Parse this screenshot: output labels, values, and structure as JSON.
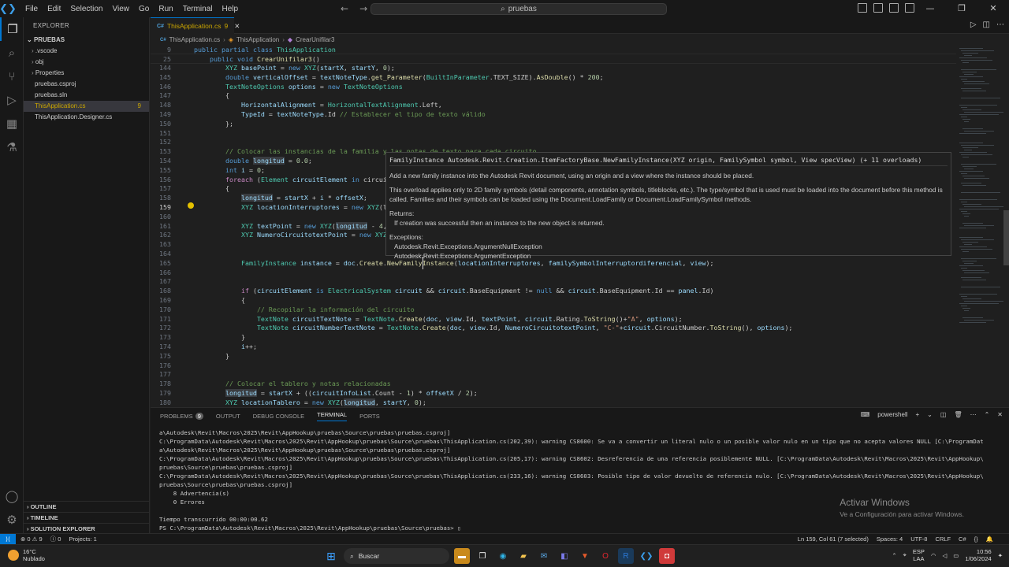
{
  "menu": [
    "File",
    "Edit",
    "Selection",
    "View",
    "Go",
    "Run",
    "Terminal",
    "Help"
  ],
  "search": "pruebas",
  "explorer": {
    "header": "EXPLORER",
    "root": "PRUEBAS",
    "items": [
      {
        "label": ".vscode",
        "type": "folder"
      },
      {
        "label": "obj",
        "type": "folder"
      },
      {
        "label": "Properties",
        "type": "folder"
      },
      {
        "label": "pruebas.csproj",
        "type": "file"
      },
      {
        "label": "pruebas.sln",
        "type": "file"
      },
      {
        "label": "ThisApplication.cs",
        "type": "file",
        "badge": "9",
        "active": true
      },
      {
        "label": "ThisApplication.Designer.cs",
        "type": "file"
      }
    ],
    "sections": [
      "OUTLINE",
      "TIMELINE",
      "SOLUTION EXPLORER"
    ]
  },
  "tab": {
    "label": "ThisApplication.cs",
    "problems": "9",
    "lang": "C#"
  },
  "breadcrumb": [
    "ThisApplication.cs",
    "ThisApplication",
    "CrearUnifilar3"
  ],
  "editor": {
    "current_line": "159",
    "sticky": [
      {
        "n": "9",
        "text": "    public partial class ThisApplication"
      },
      {
        "n": "25",
        "text": "        public void CrearUnifilar3()"
      }
    ],
    "lines": [
      {
        "n": "144",
        "text": "            XYZ basePoint = new XYZ(startX, startY, 0);"
      },
      {
        "n": "145",
        "text": "            double verticalOffset = textNoteType.get_Parameter(BuiltInParameter.TEXT_SIZE).AsDouble() * 200;"
      },
      {
        "n": "146",
        "text": "            TextNoteOptions options = new TextNoteOptions"
      },
      {
        "n": "147",
        "text": "            {"
      },
      {
        "n": "148",
        "text": "                HorizontalAlignment = HorizontalTextAlignment.Left,"
      },
      {
        "n": "149",
        "text": "                TypeId = textNoteType.Id // Establecer el tipo de texto válido"
      },
      {
        "n": "150",
        "text": "            };"
      },
      {
        "n": "151",
        "text": ""
      },
      {
        "n": "152",
        "text": ""
      },
      {
        "n": "153",
        "text": "            // Colocar las instancias de la familia y las notas de texto para cada circuito"
      },
      {
        "n": "154",
        "text": "            double longitud = 0.0;"
      },
      {
        "n": "155",
        "text": "            int i = 0;"
      },
      {
        "n": "156",
        "text": "            foreach (Element circuitElement in circui"
      },
      {
        "n": "157",
        "text": "            {"
      },
      {
        "n": "158",
        "text": "                longitud = startX + i * offsetX;"
      },
      {
        "n": "159",
        "text": "                XYZ locationInterruptores = new XYZ(l"
      },
      {
        "n": "160",
        "text": ""
      },
      {
        "n": "161",
        "text": "                XYZ textPoint = new XYZ(longitud - 4,"
      },
      {
        "n": "162",
        "text": "                XYZ NumeroCircuitotextPoint = new XYZ"
      },
      {
        "n": "163",
        "text": ""
      },
      {
        "n": "164",
        "text": ""
      },
      {
        "n": "165",
        "text": "                FamilyInstance instance = doc.Create.NewFamilyInstance(locationInterruptores, familySymbolInterruptordiferencial, view);"
      },
      {
        "n": "166",
        "text": ""
      },
      {
        "n": "167",
        "text": ""
      },
      {
        "n": "168",
        "text": "                if (circuitElement is ElectricalSystem circuit && circuit.BaseEquipment != null && circuit.BaseEquipment.Id == panel.Id)"
      },
      {
        "n": "169",
        "text": "                {"
      },
      {
        "n": "170",
        "text": "                    // Recopilar la información del circuito"
      },
      {
        "n": "171",
        "text": "                    TextNote circuitTextNote = TextNote.Create(doc, view.Id, textPoint, circuit.Rating.ToString()+\"A\", options);"
      },
      {
        "n": "172",
        "text": "                    TextNote circuitNumberTextNote = TextNote.Create(doc, view.Id, NumeroCircuitotextPoint, \"C-\"+circuit.CircuitNumber.ToString(), options);"
      },
      {
        "n": "173",
        "text": "                }"
      },
      {
        "n": "174",
        "text": "                i++;"
      },
      {
        "n": "175",
        "text": "            }"
      },
      {
        "n": "176",
        "text": ""
      },
      {
        "n": "177",
        "text": ""
      },
      {
        "n": "178",
        "text": "            // Colocar el tablero y notas relacionadas"
      },
      {
        "n": "179",
        "text": "            longitud = startX + ((circuitInfoList.Count - 1) * offsetX / 2);"
      },
      {
        "n": "180",
        "text": "            XYZ locationTablero = new XYZ(longitud, startY, 0);"
      }
    ]
  },
  "hover": {
    "signature": "FamilyInstance Autodesk.Revit.Creation.ItemFactoryBase.NewFamilyInstance(XYZ origin, FamilySymbol symbol, View specView) (+ 11 overloads)",
    "summary": "Add a new family instance into the Autodesk Revit document, using an origin and a view where the instance should be placed.",
    "detail": "This overload applies only to 2D family symbols (detail components, annotation symbols, titleblocks, etc.). The type/symbol that is used must be loaded into the document before this method is called. Families and their symbols can be loaded using the Document.LoadFamily or Document.LoadFamilySymbol methods.",
    "returns_label": "Returns:",
    "returns": "If creation was successful then an instance to the new object is returned.",
    "exceptions_label": "Exceptions:",
    "exceptions": [
      "Autodesk.Revit.Exceptions.ArgumentNullException",
      "Autodesk.Revit.Exceptions.ArgumentException"
    ]
  },
  "panel": {
    "tabs": [
      "PROBLEMS",
      "OUTPUT",
      "DEBUG CONSOLE",
      "TERMINAL",
      "PORTS"
    ],
    "problems_count": "9",
    "active_tab": "TERMINAL",
    "shell": "powershell",
    "terminal_lines": [
      "a\\Autodesk\\Revit\\Macros\\2025\\Revit\\AppHookup\\pruebas\\Source\\pruebas\\pruebas.csproj]",
      "C:\\ProgramData\\Autodesk\\Revit\\Macros\\2025\\Revit\\AppHookup\\pruebas\\Source\\pruebas\\ThisApplication.cs(202,39): warning CS8600: Se va a convertir un literal nulo o un posible valor nulo en un tipo que no acepta valores NULL [C:\\ProgramDat",
      "a\\Autodesk\\Revit\\Macros\\2025\\Revit\\AppHookup\\pruebas\\Source\\pruebas\\pruebas.csproj]",
      "C:\\ProgramData\\Autodesk\\Revit\\Macros\\2025\\Revit\\AppHookup\\pruebas\\Source\\pruebas\\ThisApplication.cs(205,17): warning CS8602: Desreferencia de una referencia posiblemente NULL. [C:\\ProgramData\\Autodesk\\Revit\\Macros\\2025\\Revit\\AppHookup\\",
      "pruebas\\Source\\pruebas\\pruebas.csproj]",
      "C:\\ProgramData\\Autodesk\\Revit\\Macros\\2025\\Revit\\AppHookup\\pruebas\\Source\\pruebas\\ThisApplication.cs(233,16): warning CS8603: Posible tipo de valor devuelto de referencia nulo. [C:\\ProgramData\\Autodesk\\Revit\\Macros\\2025\\Revit\\AppHookup\\",
      "pruebas\\Source\\pruebas\\pruebas.csproj]",
      "    8 Advertencia(s)",
      "    0 Errores",
      "",
      "Tiempo transcurrido 00:00:00.62",
      "PS C:\\ProgramData\\Autodesk\\Revit\\Macros\\2025\\Revit\\AppHookup\\pruebas\\Source\\pruebas> "
    ]
  },
  "activate": {
    "title": "Activar Windows",
    "subtitle": "Ve a Configuración para activar Windows."
  },
  "status": {
    "errors": "0",
    "warnings": "9",
    "info": "0",
    "projects": "Projects: 1",
    "position": "Ln 159, Col 61 (7 selected)",
    "spaces": "Spaces: 4",
    "encoding": "UTF-8",
    "eol": "CRLF",
    "language": "C#"
  },
  "taskbar": {
    "temp": "16°C",
    "weather": "Nublado",
    "search": "Buscar",
    "lang1": "ESP",
    "lang2": "LAA",
    "time": "10:56",
    "date": "1/06/2024"
  },
  "colors": {
    "accent": "#0078d4",
    "warning": "#cca700"
  }
}
